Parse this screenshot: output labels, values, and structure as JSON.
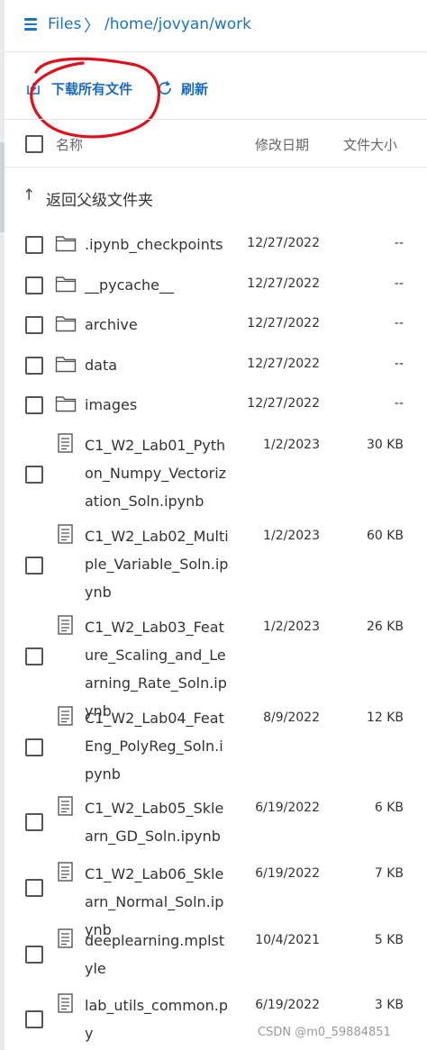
{
  "header": {
    "files_label": "Files",
    "separator": "〉",
    "path": "/home/jovyan/work"
  },
  "toolbar": {
    "download_all_label": "下载所有文件",
    "refresh_label": "刷新"
  },
  "annotation": {
    "color": "#e0101a"
  },
  "columns": {
    "name": "名称",
    "modified": "修改日期",
    "size": "文件大小"
  },
  "parent": {
    "arrow": "↑",
    "label": "返回父级文件夹"
  },
  "files": [
    {
      "type": "folder",
      "icon": "folder-icon",
      "name": ".ipynb_checkpoints",
      "date": "12/27/2022",
      "size": "--"
    },
    {
      "type": "folder",
      "icon": "folder-icon",
      "name": "__pycache__",
      "date": "12/27/2022",
      "size": "--"
    },
    {
      "type": "folder",
      "icon": "folder-icon",
      "name": "archive",
      "date": "12/27/2022",
      "size": "--"
    },
    {
      "type": "folder",
      "icon": "folder-icon",
      "name": "data",
      "date": "12/27/2022",
      "size": "--"
    },
    {
      "type": "folder",
      "icon": "folder-icon",
      "name": "images",
      "date": "12/27/2022",
      "size": "--"
    },
    {
      "type": "file",
      "icon": "file-icon",
      "name": "C1_W2_Lab01_Python_Numpy_Vectorization_Soln.ipynb",
      "date": "1/2/2023",
      "size": "30 KB"
    },
    {
      "type": "file",
      "icon": "file-icon",
      "name": "C1_W2_Lab02_Multiple_Variable_Soln.ipynb",
      "date": "1/2/2023",
      "size": "60 KB"
    },
    {
      "type": "file",
      "icon": "file-icon",
      "name": "C1_W2_Lab03_Feature_Scaling_and_Learning_Rate_Soln.ipynb",
      "date": "1/2/2023",
      "size": "26 KB"
    },
    {
      "type": "file",
      "icon": "file-icon",
      "name": "C1_W2_Lab04_FeatEng_PolyReg_Soln.ipynb",
      "date": "8/9/2022",
      "size": "12 KB"
    },
    {
      "type": "file",
      "icon": "file-icon",
      "name": "C1_W2_Lab05_Sklearn_GD_Soln.ipynb",
      "date": "6/19/2022",
      "size": "6 KB"
    },
    {
      "type": "file",
      "icon": "file-icon",
      "name": "C1_W2_Lab06_Sklearn_Normal_Soln.ipynb",
      "date": "6/19/2022",
      "size": "7 KB"
    },
    {
      "type": "file",
      "icon": "file-icon",
      "name": "deeplearning.mplstyle",
      "date": "10/4/2021",
      "size": "5 KB"
    },
    {
      "type": "file",
      "icon": "file-icon",
      "name": "lab_utils_common.py",
      "date": "6/19/2022",
      "size": "3 KB"
    }
  ],
  "watermark": "CSDN @m0_59884851"
}
